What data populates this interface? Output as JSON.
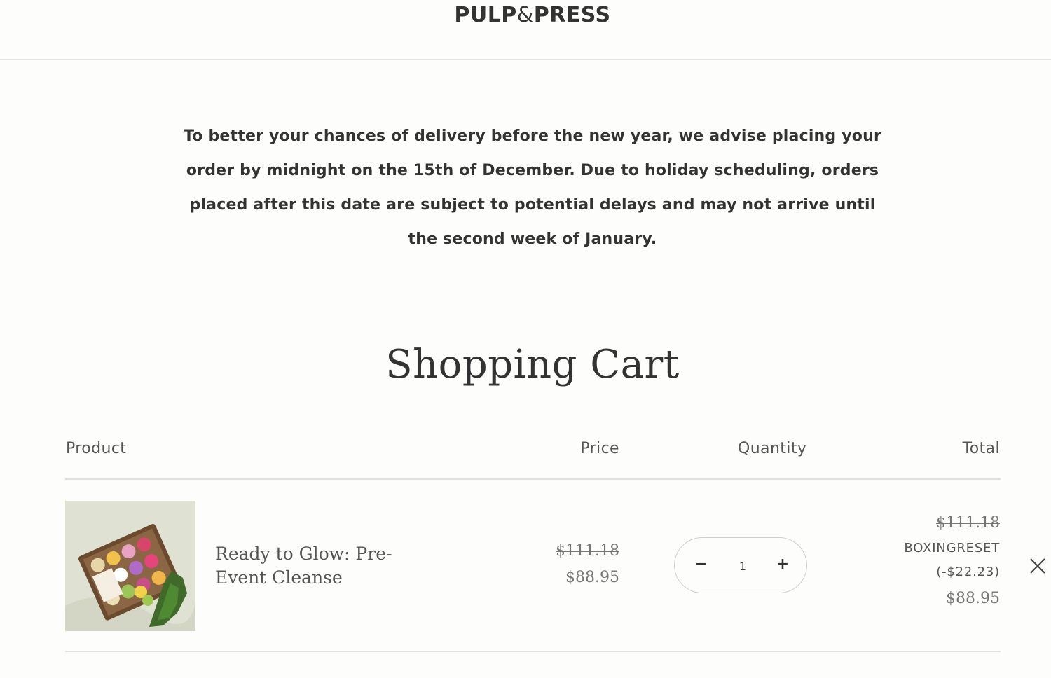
{
  "header": {
    "logo_left": "PULP",
    "logo_amp": "&",
    "logo_right": "PRESS"
  },
  "notice": {
    "text": "To better your chances of delivery before the new year, we advise placing your order by midnight on the 15th of December. Due to holiday scheduling, orders placed after this date are subject to potential delays and may not arrive until the second week of January."
  },
  "cart": {
    "title": "Shopping Cart",
    "columns": {
      "product": "Product",
      "price": "Price",
      "quantity": "Quantity",
      "total": "Total"
    },
    "items": [
      {
        "name": "Ready to Glow: Pre-Event Cleanse",
        "image_icon": "juice-box-product-image",
        "price_original": "$111.18",
        "price_sale": "$88.95",
        "quantity": "1",
        "qty_minus": "−",
        "qty_plus": "+",
        "total_original": "$111.18",
        "discount_code": "BOXINGRESET",
        "discount_amount": "(-$22.23)",
        "total_final": "$88.95",
        "remove_icon": "close-icon"
      }
    ]
  }
}
